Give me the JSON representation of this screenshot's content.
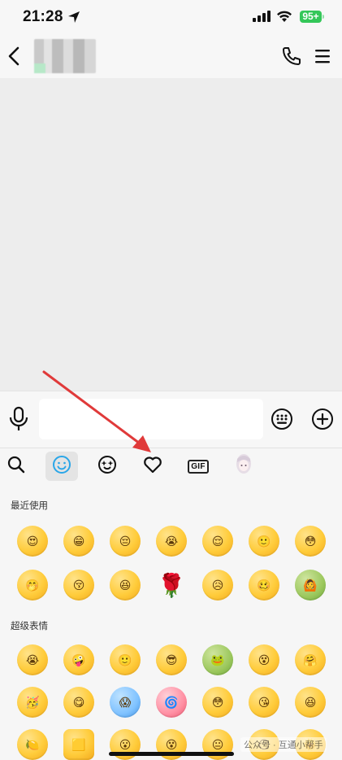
{
  "status_bar": {
    "time": "21:28",
    "battery": "95+",
    "location_icon": "location-arrow-icon",
    "signal_icon": "cellular-signal-icon",
    "wifi_icon": "wifi-icon",
    "battery_color": "#34c759"
  },
  "nav": {
    "back_icon": "chevron-left-icon",
    "call_icon": "phone-icon",
    "menu_icon": "menu-icon"
  },
  "input_bar": {
    "voice_icon": "microphone-icon",
    "message_value": "",
    "sticker_icon": "keyboard-dots-icon",
    "more_icon": "plus-circle-icon"
  },
  "emoji_tabs": [
    {
      "icon": "search-icon",
      "active": false
    },
    {
      "icon": "smiley-icon",
      "active": true
    },
    {
      "icon": "sparkle-face-icon",
      "active": false
    },
    {
      "icon": "heart-icon",
      "active": false
    },
    {
      "label": "GIF",
      "active": false
    },
    {
      "icon": "avatar-sticker-icon",
      "active": false
    }
  ],
  "sections": {
    "recent": "最近使用",
    "super": "超级表情"
  },
  "recent_emoji": [
    "😍",
    "😁",
    "😔",
    "😭",
    "😌",
    "🙂",
    "😳",
    "🤭",
    "😚",
    "😆",
    "🌹",
    "😥",
    "🥴",
    "🙆"
  ],
  "super_emoji": [
    "😭",
    "🤪",
    "🙂",
    "😎",
    "🐸",
    "😵",
    "🤗",
    "🥳",
    "😋",
    "😱",
    "🌀",
    "😳",
    "😘",
    "😆",
    "🍋",
    "🟨",
    "😮",
    "😵",
    "😐",
    "😶",
    "🌞"
  ],
  "watermark": "公众号 · 互通小帮手",
  "annotation_color": "#e03a3a"
}
